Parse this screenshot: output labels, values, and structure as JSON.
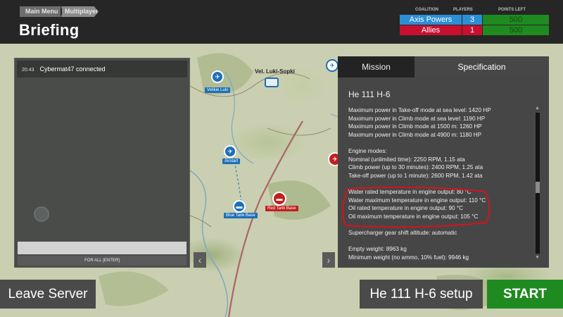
{
  "header": {
    "breadcrumbs": [
      "Main Menu",
      "Multiplayer"
    ],
    "title": "Briefing"
  },
  "coalition_table": {
    "headers": [
      "COALITION",
      "PLAYERS",
      "POINTS LEFT"
    ],
    "rows": [
      {
        "coalition": "Axis Powers",
        "players": "3",
        "points": "500",
        "color": "#2a8fd6"
      },
      {
        "coalition": "Allies",
        "players": "1",
        "points": "500",
        "color": "#c8102e"
      }
    ],
    "points_color": "#1f8a1f"
  },
  "chat": {
    "messages": [
      {
        "time": "20:43",
        "text": "Cybermat47 connected"
      }
    ],
    "send_label": "FOR ALL [ENTER]"
  },
  "map": {
    "city_label": "Vel. Luki-Sopki",
    "markers": [
      {
        "label": "Velikie Luki",
        "icon": "airfield-icon"
      },
      {
        "label": "Airstart",
        "icon": "airstart-icon"
      },
      {
        "label": "Blue Tank Base",
        "icon": "tank-icon"
      },
      {
        "label": "Red Tank Base",
        "icon": "tank-icon"
      }
    ]
  },
  "tabs": {
    "mission": "Mission",
    "specification": "Specification"
  },
  "spec": {
    "title": "He 111 H-6",
    "lines": [
      "Maximum power in Take-off mode at sea level: 1420 HP",
      "Maximum power in Climb mode at sea level: 1190 HP",
      "Maximum power in Climb mode at 1500 m: 1260 HP",
      "Maximum power in Climb mode at 4900 m: 1180 HP",
      "",
      "Engine modes:",
      "Nominal (unlimited time): 2250 RPM, 1.15 ata",
      "Climb power (up to 30 minutes): 2400 RPM, 1.25 ata",
      "Take-off power (up to 1 minute): 2600 RPM, 1.42 ata",
      "",
      "Water rated temperature in engine output: 80 °C",
      "Water maximum temperature in engine output: 110 °C",
      "Oil rated temperature in engine output: 90 °C",
      "Oil maximum temperature in engine output: 105 °C",
      "",
      "Supercharger gear shift altitude: automatic",
      "",
      "Empty weight: 8963 kg",
      "Minimum weight (no ammo, 10% fuel): 9946 kg"
    ],
    "highlight_color": "#d4141c"
  },
  "buttons": {
    "leave": "Leave Server",
    "setup": "He 111 H-6 setup",
    "start": "START"
  }
}
